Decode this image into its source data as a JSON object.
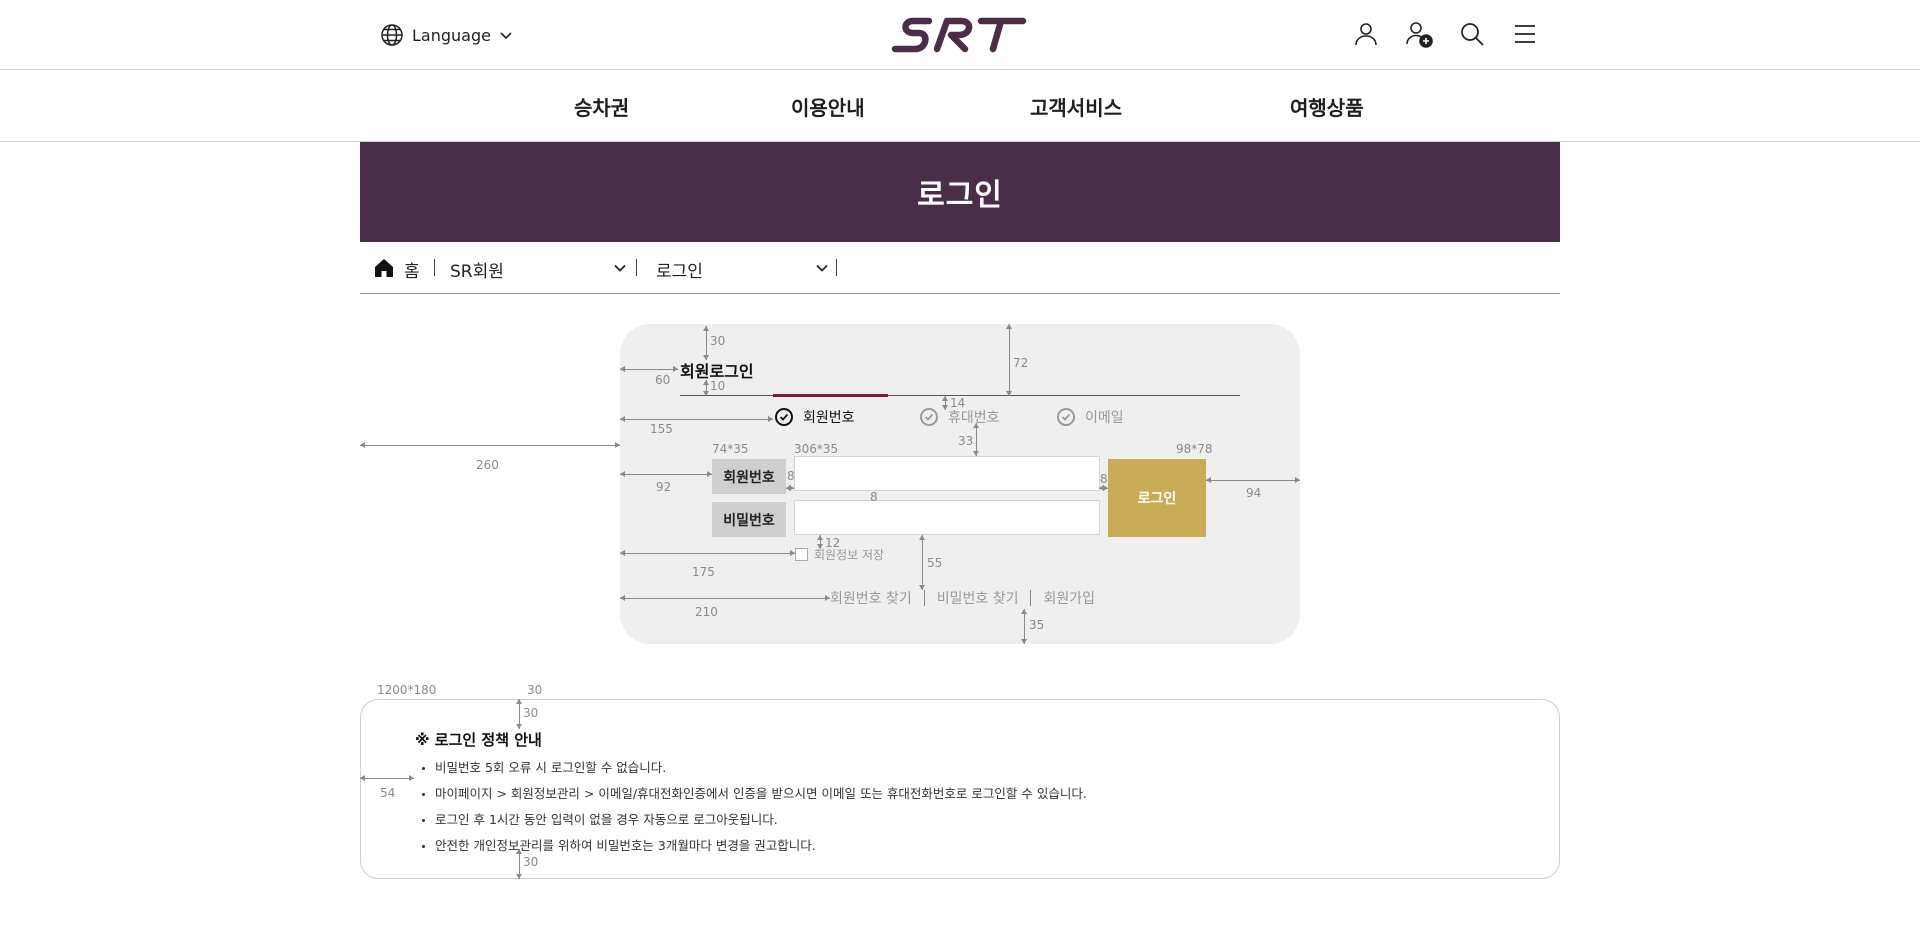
{
  "header": {
    "language_label": "Language",
    "icons": [
      "user-icon",
      "user-add-icon",
      "search-icon",
      "menu-icon"
    ],
    "logo_text": "SRT",
    "brand_color": "#4a2e48"
  },
  "gnb": {
    "items": [
      "승차권",
      "이용안내",
      "고객서비스",
      "여행상품"
    ]
  },
  "banner": {
    "title": "로그인"
  },
  "breadcrumb": {
    "home": "홈",
    "level1": "SR회원",
    "level2": "로그인"
  },
  "login": {
    "title": "회원로그인",
    "options": [
      {
        "label": "회원번호",
        "selected": true
      },
      {
        "label": "휴대번호",
        "selected": false
      },
      {
        "label": "이메일",
        "selected": false
      }
    ],
    "member_number_label": "회원번호",
    "password_label": "비밀번호",
    "member_number_value": "",
    "password_value": "",
    "login_button": "로그인",
    "login_button_color": "#c8ac56",
    "remember_label": "회원정보 저장",
    "links": [
      "회원번호 찾기",
      "비밀번호 찾기",
      "회원가입"
    ]
  },
  "annotations": {
    "d30": "30",
    "d60": "60",
    "d10": "10",
    "d72": "72",
    "d14": "14",
    "d155": "155",
    "d260": "260",
    "d33": "33",
    "label_size": "74*35",
    "input_size": "306*35",
    "button_size": "98*78",
    "d92": "92",
    "d8a": "8",
    "d8b": "8",
    "d8c": "8",
    "d94": "94",
    "d12": "12",
    "d55": "55",
    "d175": "175",
    "d210": "210",
    "d35": "35",
    "policy_size": "1200*180",
    "p30a": "30",
    "p30b": "30",
    "p54": "54",
    "p30c": "30"
  },
  "policy": {
    "title": "※ 로그인 정책 안내",
    "items": [
      "비밀번호 5회 오류 시 로그인할 수 없습니다.",
      "마이페이지 > 회원정보관리 > 이메일/휴대전화인증에서 인증을 받으시면 이메일 또는 휴대전화번호로 로그인할 수 있습니다.",
      "로그인 후 1시간 동안 입력이 없을 경우 자동으로 로그아웃됩니다.",
      "안전한 개인정보관리를 위하여 비밀번호는 3개월마다 변경을 권고합니다."
    ]
  }
}
